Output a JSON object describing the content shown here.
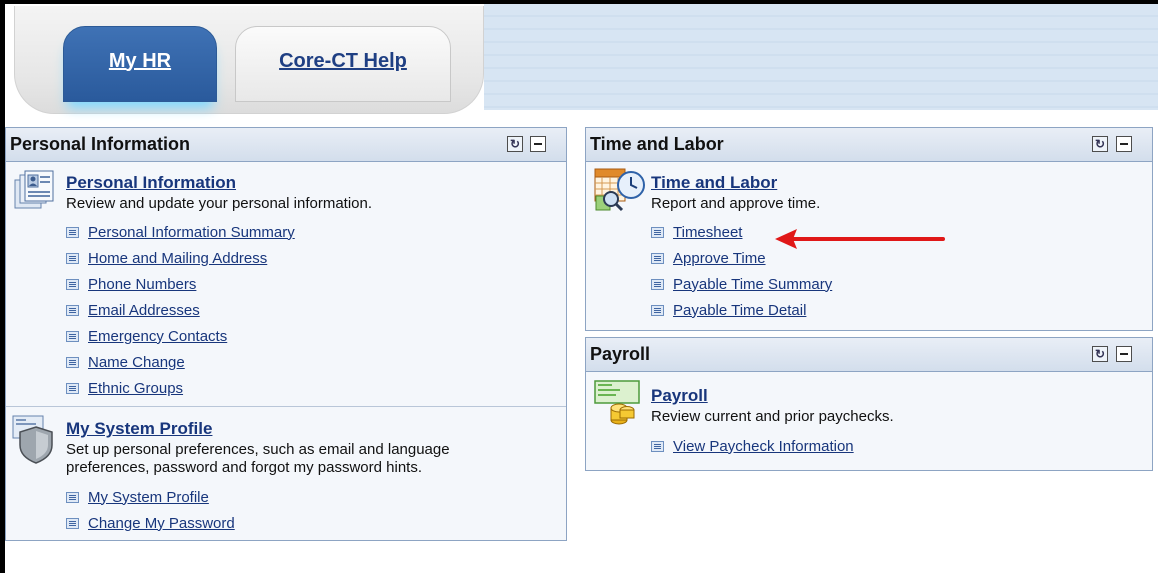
{
  "tabs": [
    {
      "label": "My HR",
      "active": true
    },
    {
      "label": "Core-CT Help",
      "active": false
    }
  ],
  "colors": {
    "tab_active": "#2f62a8",
    "link": "#18367c",
    "pagelet_border": "#8da4c3",
    "annotation_arrow": "#e01818"
  },
  "personal": {
    "title": "Personal Information",
    "group1": {
      "link": "Personal Information",
      "desc": "Review and update your personal information.",
      "icon": "personal-info-icon",
      "items": [
        "Personal Information Summary",
        "Home and Mailing Address",
        "Phone Numbers",
        "Email Addresses",
        "Emergency Contacts",
        "Name Change",
        "Ethnic Groups"
      ]
    },
    "group2": {
      "link": "My System Profile",
      "desc_line1": "Set up personal preferences, such as email and language",
      "desc_line2": "preferences, password and forgot my password hints.",
      "icon": "shield-icon",
      "items": [
        "My System Profile",
        "Change My Password"
      ]
    }
  },
  "time": {
    "title": "Time and Labor",
    "link": "Time and Labor",
    "desc": "Report and approve time.",
    "icon": "calendar-clock-icon",
    "items": [
      "Timesheet",
      "Approve Time",
      "Payable Time Summary",
      "Payable Time Detail"
    ]
  },
  "payroll": {
    "title": "Payroll",
    "link": "Payroll",
    "desc": "Review current and prior paychecks.",
    "icon": "paycheck-coins-icon",
    "items": [
      "View Paycheck Information"
    ]
  }
}
